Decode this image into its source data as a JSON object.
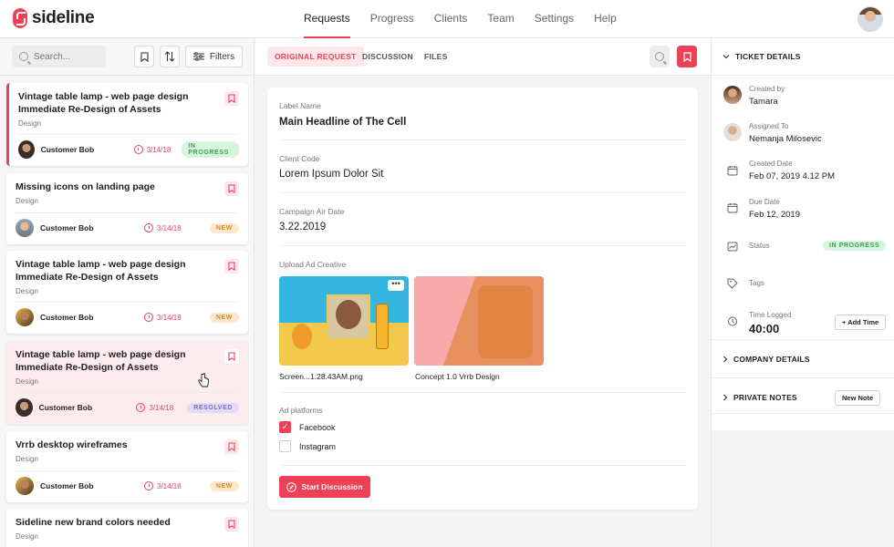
{
  "app": {
    "name": "sideline"
  },
  "nav": [
    "Requests",
    "Progress",
    "Clients",
    "Team",
    "Settings",
    "Help"
  ],
  "toolbar": {
    "search_placeholder": "Search...",
    "filters_label": "Filters"
  },
  "tickets": [
    {
      "title": "Vintage table lamp - web page design Immediate Re-Design of Assets",
      "category": "Design",
      "customer": "Customer Bob",
      "date": "3/14/18",
      "status": "IN PROGRESS"
    },
    {
      "title": "Missing icons on landing page",
      "category": "Design",
      "customer": "Customer Bob",
      "date": "3/14/18",
      "status": "NEW"
    },
    {
      "title": "Vintage table lamp - web page design Immediate Re-Design of Assets",
      "category": "Design",
      "customer": "Customer Bob",
      "date": "3/14/18",
      "status": "NEW"
    },
    {
      "title": "Vintage table lamp - web page design Immediate Re-Design of Assets",
      "category": "Design",
      "customer": "Customer Bob",
      "date": "3/14/18",
      "status": "RESOLVED"
    },
    {
      "title": "Vrrb desktop wireframes",
      "category": "Design",
      "customer": "Customer Bob",
      "date": "3/14/18",
      "status": "NEW"
    },
    {
      "title": "Sideline new brand colors needed",
      "category": "Design"
    }
  ],
  "tabs": [
    "ORIGINAL REQUEST",
    "DISCUSSION",
    "FILES"
  ],
  "request": {
    "label_name_label": "Label Name",
    "label_name": "Main Headline of The Cell",
    "client_code_label": "Client Code",
    "client_code": "Lorem Ipsum Dolor Sit",
    "air_date_label": "Campaign Air Date",
    "air_date": "3.22.2019",
    "upload_label": "Upload Ad Creative",
    "files": [
      "Screen...1.28.43AM.png",
      "Concept 1.0 Vrrb Design"
    ],
    "platforms_label": "Ad platforms",
    "platforms": [
      {
        "name": "Facebook",
        "checked": true
      },
      {
        "name": "Instagram",
        "checked": false
      }
    ],
    "start_button": "Start Discussion"
  },
  "details": {
    "heading": "TICKET DETAILS",
    "created_by_label": "Created by",
    "created_by": "Tamara",
    "assigned_label": "Assigned To",
    "assigned": "Nemanja Milosevic",
    "created_date_label": "Created Date",
    "created_date": "Feb 07, 2019 4.12 PM",
    "due_label": "Due Date",
    "due": "Feb 12, 2019",
    "status_label": "Status",
    "status": "IN PROGRESS",
    "tags_label": "Tags",
    "time_label": "Time Logged",
    "time": "40:00",
    "add_time": "+ Add Time",
    "company_heading": "COMPANY DETAILS",
    "notes_heading": "PRIVATE NOTES",
    "new_note": "New Note"
  },
  "colors": {
    "accent": "#ee4158",
    "success": "#34a853",
    "new": "#d88b1c",
    "resolved": "#7c6ad1"
  }
}
